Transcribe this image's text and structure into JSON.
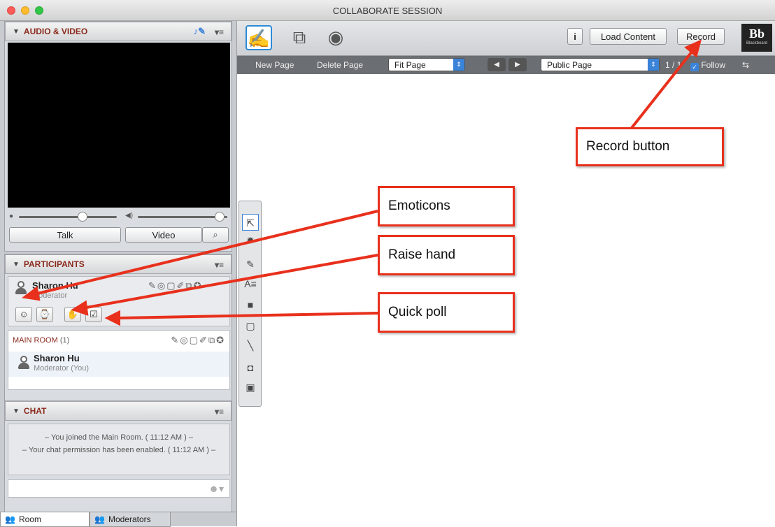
{
  "window": {
    "title": "COLLABORATE SESSION"
  },
  "audio_video": {
    "header": "AUDIO & VIDEO",
    "talk": "Talk",
    "video": "Video"
  },
  "participants": {
    "header": "PARTICIPANTS",
    "me": {
      "name": "Sharon Hu",
      "role": "Moderator"
    },
    "room": {
      "label": "MAIN ROOM",
      "count": "(1)",
      "person_name": "Sharon Hu",
      "person_role": "Moderator (You)"
    }
  },
  "chat": {
    "header": "CHAT",
    "messages": [
      "– You joined the Main Room. ( 11:12 AM ) –",
      "– Your chat permission has been enabled. ( 11:12 AM ) –"
    ],
    "tabs": [
      "Room",
      "Moderators"
    ]
  },
  "toolbar": {
    "info": "i",
    "load_content": "Load Content",
    "record": "Record",
    "brand": "Bb",
    "brand_sub": "Blackboard"
  },
  "subbar": {
    "new_page": "New Page",
    "delete_page": "Delete Page",
    "zoom": "Fit Page",
    "page_type": "Public Page",
    "page_num": "1 / 1",
    "follow": "Follow"
  },
  "callouts": {
    "record": "Record button",
    "emoticons": "Emoticons",
    "raise_hand": "Raise hand",
    "quick_poll": "Quick poll"
  },
  "colors": {
    "callout_border": "#e8301c",
    "accent": "#3a83d9",
    "header_text": "#8a2a1c"
  }
}
